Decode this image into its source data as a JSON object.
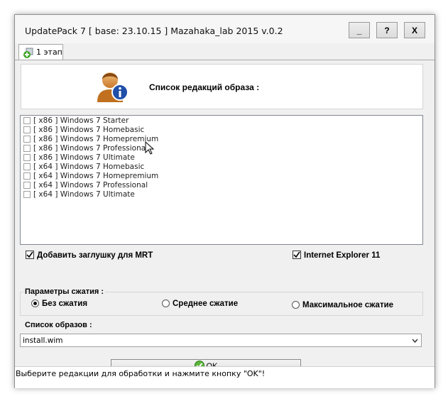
{
  "window": {
    "title": "UpdatePack 7 [ base: 23.10.15 ] Mazahaka_lab 2015 v.0.2",
    "buttons": {
      "minimize": "_",
      "help": "?",
      "close": "X"
    }
  },
  "tabs": [
    {
      "label": "1 этап",
      "icon": "add-package-icon"
    }
  ],
  "header": {
    "title": "Список редакций образа :",
    "icon": "user-info-icon"
  },
  "editions": [
    {
      "label": "[ x86 ] Windows 7 Starter",
      "checked": false
    },
    {
      "label": "[ x86 ] Windows 7 Homebasic",
      "checked": false
    },
    {
      "label": "[ x86 ] Windows 7 Homepremium",
      "checked": false
    },
    {
      "label": "[ x86 ] Windows 7 Professional",
      "checked": false
    },
    {
      "label": "[ x86 ] Windows 7 Ultimate",
      "checked": false
    },
    {
      "label": "[ x64 ] Windows 7 Homebasic",
      "checked": false
    },
    {
      "label": "[ x64 ] Windows 7 Homepremium",
      "checked": false
    },
    {
      "label": "[ x64 ] Windows 7 Professional",
      "checked": false
    },
    {
      "label": "[ x64 ] Windows 7 Ultimate",
      "checked": false
    }
  ],
  "options": {
    "mrt_stub": {
      "label": "Добавить заглушку для MRT",
      "checked": true
    },
    "ie11": {
      "label": "Internet Explorer 11",
      "checked": true
    }
  },
  "compression": {
    "label": "Параметры сжатия :",
    "options": [
      {
        "label": "Без сжатия",
        "selected": true
      },
      {
        "label": "Среднее сжатие",
        "selected": false
      },
      {
        "label": "Максимальное сжатие",
        "selected": false
      }
    ]
  },
  "images": {
    "label": "Список образов :",
    "value": "install.wim"
  },
  "ok_button": {
    "label": "OK"
  },
  "status": {
    "text": "Выберите  редакции для обработки и нажмите кнопку \"OK\"!"
  }
}
